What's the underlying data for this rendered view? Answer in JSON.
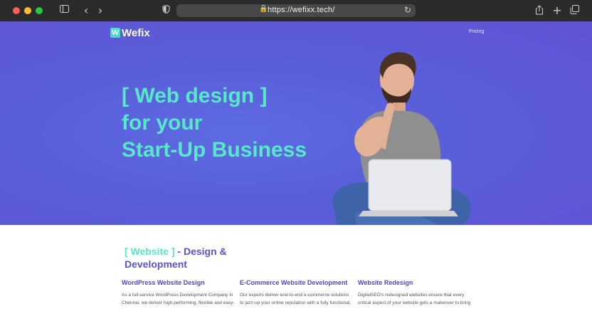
{
  "browser": {
    "url": "https://wefixx.tech/"
  },
  "site": {
    "logo_letter": "W",
    "logo_text": "Wefix",
    "nav": {
      "pricing": "Pricing"
    },
    "hero": {
      "line1": "[ Web design ]",
      "line2": "for your",
      "line3": "Start-Up Business"
    },
    "section": {
      "heading_accent": "[ Website ]",
      "heading_rest": " - Design &",
      "heading_line2": "Development"
    },
    "columns": [
      {
        "title": "WordPress Website Design",
        "text": "As a full-service WordPress Development Company in Chennai, we deliver high-performing, flexible and easy-to-"
      },
      {
        "title": "E-Commerce Website Development",
        "text": "Our experts deliver end-to-end e-commerce solutions to jazz-up your online reputation with a fully functional,"
      },
      {
        "title": "Website Redesign",
        "text": "DigitalSEO's redesigned websites ensure that every critical aspect of your website gets a makeover to bring a"
      }
    ]
  },
  "colors": {
    "accent": "#57e8c9",
    "brand": "#5b54d2",
    "hero_bg": "#5e63dc"
  }
}
